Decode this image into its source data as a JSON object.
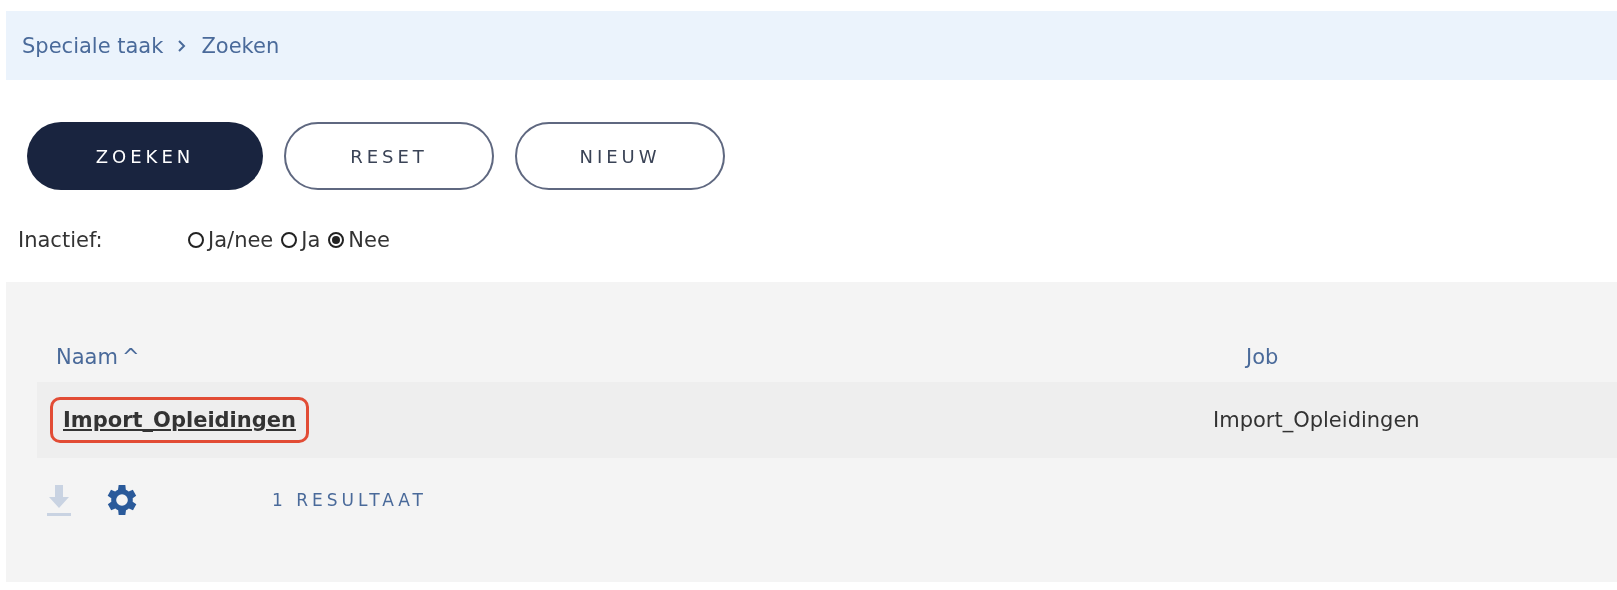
{
  "breadcrumb": [
    "Speciale taak",
    "Zoeken"
  ],
  "buttons": [
    {
      "label": "ZOEKEN",
      "kind": "primary"
    },
    {
      "label": "RESET",
      "kind": "outline"
    },
    {
      "label": "NIEUW",
      "kind": "outline"
    }
  ],
  "filter": {
    "label": "Inactief:",
    "options": [
      {
        "label": "Ja/nee",
        "selected": false
      },
      {
        "label": "Ja",
        "selected": false
      },
      {
        "label": "Nee",
        "selected": true
      }
    ]
  },
  "table": {
    "columns": [
      {
        "label": "Naam",
        "sort_icon": "^"
      },
      {
        "label": "Job"
      }
    ],
    "rows": [
      {
        "name": "Import_Opleidingen",
        "job": "Import_Opleidingen",
        "highlighted": true
      }
    ]
  },
  "footer": {
    "result_count": "1 RESULTAAT"
  }
}
